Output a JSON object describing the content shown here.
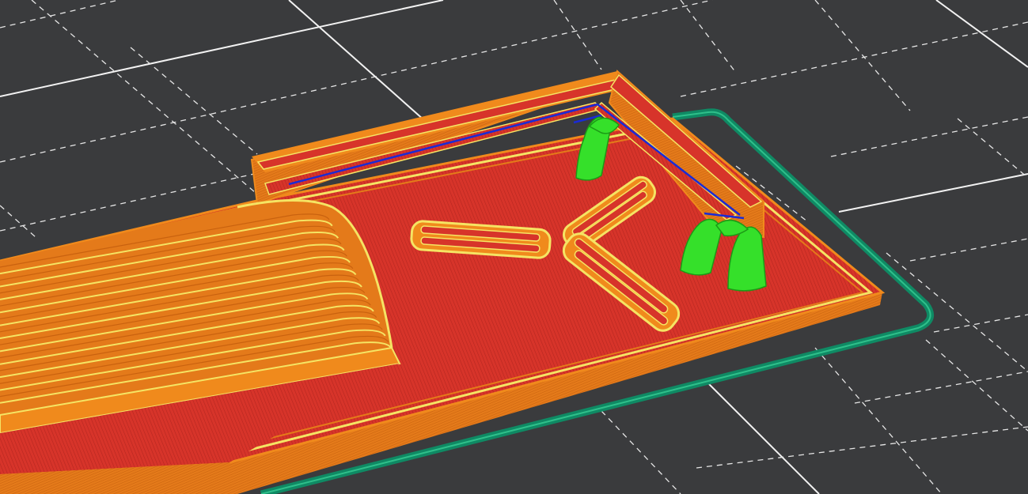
{
  "view": {
    "kind": "gcode-layer-preview",
    "colors": {
      "background": "#3a3b3d",
      "grid_major": "#f2f2f2",
      "grid_minor": "#e6e6e6",
      "perimeter_outer": "#f08a1c",
      "perimeter_inner": "#f5e463",
      "solid_infill": "#d7342a",
      "infill_hatch": "#b52620",
      "support": "#35e02a",
      "support_dark": "#1c9a16",
      "travel": "#1a2bd6",
      "skirt": "#0f8a64",
      "skirt_light": "#2fbf8a",
      "model_side": "#e47a1a"
    }
  }
}
